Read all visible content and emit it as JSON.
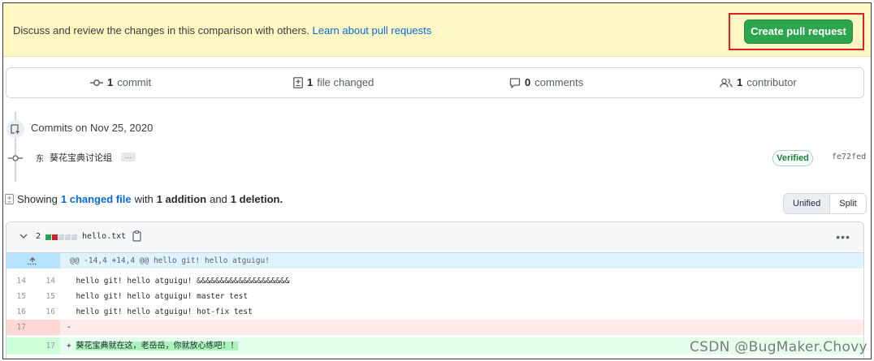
{
  "banner": {
    "text": "Discuss and review the changes in this comparison with others.",
    "link": "Learn about pull requests",
    "button": "Create pull request",
    "accent": "#2da44e",
    "highlight_box": "#e02020"
  },
  "stats": {
    "commits_count": "1",
    "commits_label": "commit",
    "files_count": "1",
    "files_label": "file changed",
    "comments_count": "0",
    "comments_label": "comments",
    "contributors_count": "1",
    "contributors_label": "contributor"
  },
  "commits": {
    "heading": "Commits on Nov 25, 2020",
    "author": "东",
    "message": "葵花宝典讨论组",
    "more": "…",
    "verified": "Verified",
    "sha": "fe72fed"
  },
  "summary": {
    "showing": "Showing",
    "changed_link": "1 changed file",
    "with": "with",
    "additions": "1 addition",
    "and": "and",
    "deletions": "1 deletion."
  },
  "view_toggle": {
    "unified": "Unified",
    "split": "Split"
  },
  "file": {
    "count": "2",
    "name": "hello.txt",
    "hunk": "@@ -14,4 +14,4 @@ hello git! hello atguigu!",
    "lines": [
      {
        "old": "14",
        "new": "14",
        "text": "  hello git! hello atguigu! &&&&&&&&&&&&&&&&&&&&"
      },
      {
        "old": "15",
        "new": "15",
        "text": "  hello git! hello atguigu! master test"
      },
      {
        "old": "16",
        "new": "16",
        "text": "  hello git! hello atguigu! hot-fix test"
      }
    ],
    "deleted_line": {
      "old": "17",
      "text": "-"
    },
    "added_line": {
      "new": "17",
      "prefix": "+ ",
      "text": "葵花宝典就在这，老岳岳，你就放心练吧！！"
    }
  },
  "watermark": "CSDN @BugMaker.Chovy"
}
